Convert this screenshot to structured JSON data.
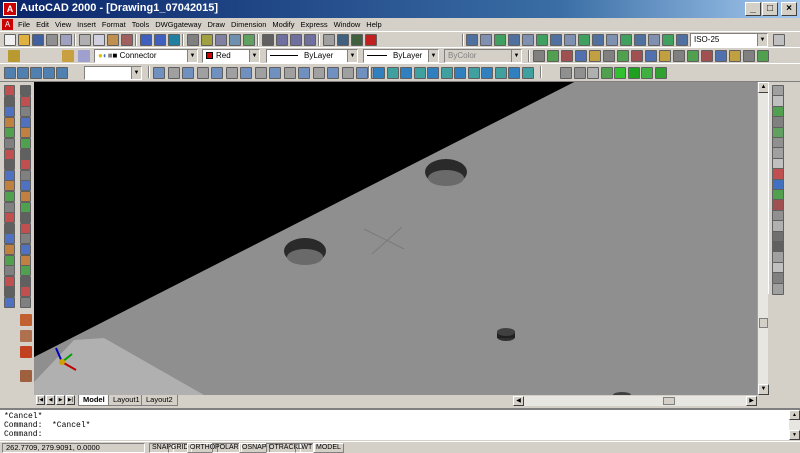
{
  "window": {
    "title": "AutoCAD 2000 - [Drawing1_07042015]",
    "app_icon": "autocad-logo-icon",
    "controls": [
      "minimize-icon",
      "maximize-icon",
      "close-icon"
    ]
  },
  "menubar": {
    "doc_icon": "document-icon",
    "items": [
      "File",
      "Edit",
      "View",
      "Insert",
      "Format",
      "Tools",
      "DWGgateway",
      "Draw",
      "Dimension",
      "Modify",
      "Express",
      "Window",
      "Help"
    ]
  },
  "toolbars": {
    "standard": {
      "dimstyle": "ISO-25"
    },
    "layers": {
      "layer": "Connector",
      "color": "Red",
      "linetype": "ByLayer",
      "lineweight": "ByLayer",
      "plotstyle": "ByColor",
      "colors": {
        "red": "#d00000"
      }
    },
    "view": {
      "ucs_dropdown": ""
    }
  },
  "viewport": {
    "background_color": "#000000",
    "surface_color": "#8f8f8f",
    "ucs_icon": "ucs-axis-icon",
    "crosshair": "crosshair-cursor"
  },
  "layout_tabs": [
    "Model",
    "Layout1",
    "Layout2"
  ],
  "command_window": {
    "lines": [
      "*Cancel*",
      "Command:  *Cancel*",
      "Command:"
    ]
  },
  "statusbar": {
    "coords": "262.7709, 279.9091, 0.0000",
    "toggles": [
      "SNAP",
      "GRID",
      "ORTHO",
      "POLAR",
      "OSNAP",
      "OTRACK",
      "LWT",
      "MODEL"
    ]
  }
}
